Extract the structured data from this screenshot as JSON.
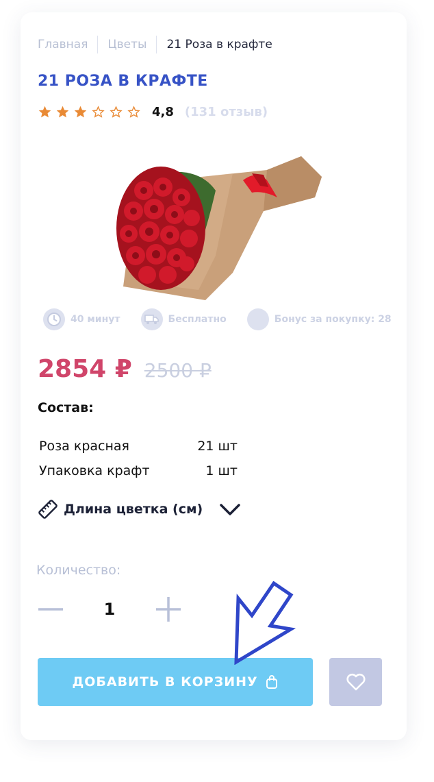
{
  "breadcrumb": [
    "Главная",
    "Цветы",
    "21 Роза в крафте"
  ],
  "product": {
    "title": "21 РОЗА В КРАФТЕ",
    "rating": {
      "value": "4,8",
      "stars_filled": 3,
      "stars_total": 6,
      "reviews": "(131 отзыв)"
    },
    "image": "bouquet-of-red-roses-in-kraft-paper"
  },
  "features": [
    {
      "icon": "clock-icon",
      "label": "40 минут"
    },
    {
      "icon": "truck-icon",
      "label": "Бесплатно"
    },
    {
      "icon": "bonus-icon",
      "label": "Бонус за покупку: 28"
    }
  ],
  "price": {
    "current": "2854 ₽",
    "old": "2500 ₽"
  },
  "composition": {
    "title": "Состав:",
    "items": [
      {
        "name": "Роза красная",
        "qty": "21 шт"
      },
      {
        "name": "Упаковка крафт",
        "qty": "1 шт"
      }
    ]
  },
  "length": {
    "label": "Длина цветка (см)",
    "icon": "ruler-icon"
  },
  "quantity": {
    "label": "Количество:",
    "value": "1"
  },
  "actions": {
    "add_to_cart": "ДОБАВИТЬ В КОРЗИНУ",
    "favorite_icon": "heart-icon"
  },
  "colors": {
    "accent_blue": "#3753c6",
    "price_red": "#d0456a",
    "star_orange": "#e98a35",
    "button_blue": "#6ecbf4",
    "fav_button": "#c2c8e3"
  }
}
